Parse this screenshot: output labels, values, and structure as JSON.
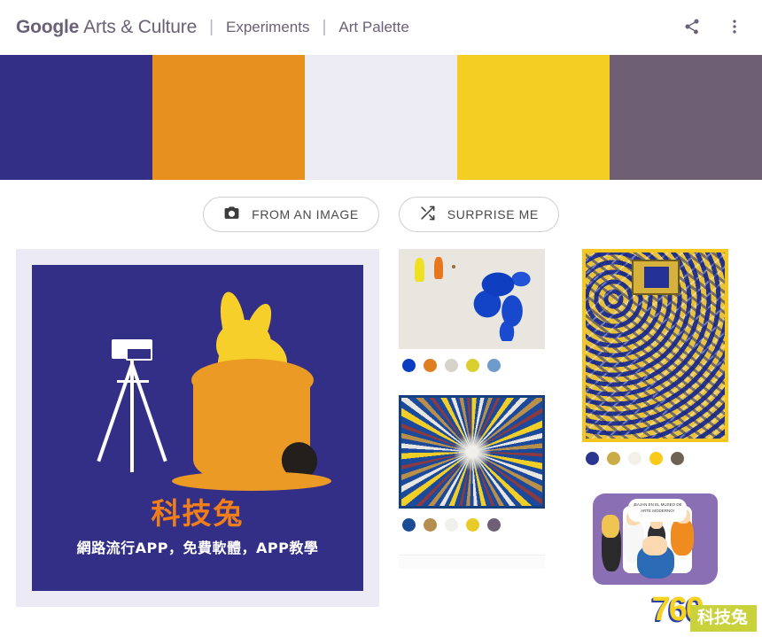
{
  "header": {
    "brand_google": "Google",
    "brand_rest": "Arts & Culture",
    "separator": "|",
    "nav": [
      {
        "label": "Experiments"
      },
      {
        "label": "Art Palette"
      }
    ],
    "share_icon": "share-icon",
    "menu_icon": "more-vertical-icon"
  },
  "palette_bar": {
    "swatches": [
      {
        "name": "indigo",
        "hex": "#332F86"
      },
      {
        "name": "orange",
        "hex": "#E8901F"
      },
      {
        "name": "off-white",
        "hex": "#EDECF5"
      },
      {
        "name": "yellow",
        "hex": "#F5CE23"
      },
      {
        "name": "purple-gray",
        "hex": "#6E5F74"
      }
    ]
  },
  "actions": {
    "from_image_label": "FROM AN IMAGE",
    "from_image_icon": "camera-icon",
    "surprise_label": "SURPRISE ME",
    "surprise_icon": "shuffle-icon"
  },
  "source": {
    "title": "科技兔",
    "subtitle": "網路流行APP，免費軟體，APP教學",
    "background": "#332F86",
    "frame": "#ECEAF5",
    "title_color": "#F07F1A",
    "subtitle_color": "#FFFFFF",
    "rabbit_color": "#F6CF2A",
    "hat_color": "#EB9A25",
    "tripod_color": "#FFFFFF"
  },
  "results": {
    "middle_column": [
      {
        "name": "abstract-blue-splash",
        "thumb_bg": "#E9E6DF",
        "dots": [
          "#0B3CC1",
          "#DF7F22",
          "#D6D3CB",
          "#D9D02F",
          "#6E9BCB"
        ]
      },
      {
        "name": "radial-starburst",
        "thumb_bg": "#1B4A9C",
        "dots": [
          "#1B4B96",
          "#B58E4F",
          "#EFEFEE",
          "#E9CB27",
          "#6E5F74"
        ]
      },
      {
        "name": "partial-card",
        "thumb_bg": "#FBFBFB",
        "dots": []
      }
    ],
    "right_column": [
      {
        "name": "ornate-gold-blue",
        "thumb_bg": "#C9A63C",
        "dots": [
          "#2B3691",
          "#CAAB45",
          "#F2F0E7",
          "#FAC91A",
          "#6E6352"
        ]
      },
      {
        "name": "cartoon-museum",
        "thumb_bg": "#FFFFFF",
        "speech_text": "¡BAJAN EN EL MUSEO DE ARTE MODERNO!",
        "dots": []
      }
    ]
  },
  "watermark": {
    "number": "760",
    "text": "科技兔",
    "badge_color": "#C9D23A",
    "number_color": "#F5D31E"
  }
}
